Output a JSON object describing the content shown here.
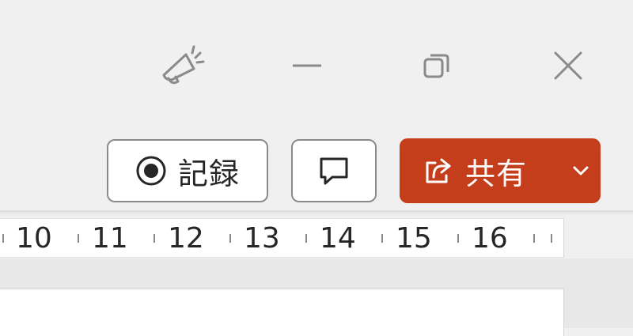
{
  "toolbar": {
    "record_label": "記録",
    "share_label": "共有"
  },
  "icons": {
    "designer": "megaphone-icon",
    "minimize": "minimize-icon",
    "restore": "restore-icon",
    "close": "close-icon",
    "record": "record-dot-icon",
    "comment": "comment-icon",
    "share": "share-arrow-icon",
    "share_dropdown": "chevron-down-icon"
  },
  "ruler": {
    "numbers": [
      "10",
      "11",
      "12",
      "13",
      "14",
      "15",
      "16"
    ]
  },
  "colors": {
    "share_bg": "#c43e1c",
    "window_bg": "#f0f0f0",
    "icon_gray": "#8a8a8a"
  }
}
